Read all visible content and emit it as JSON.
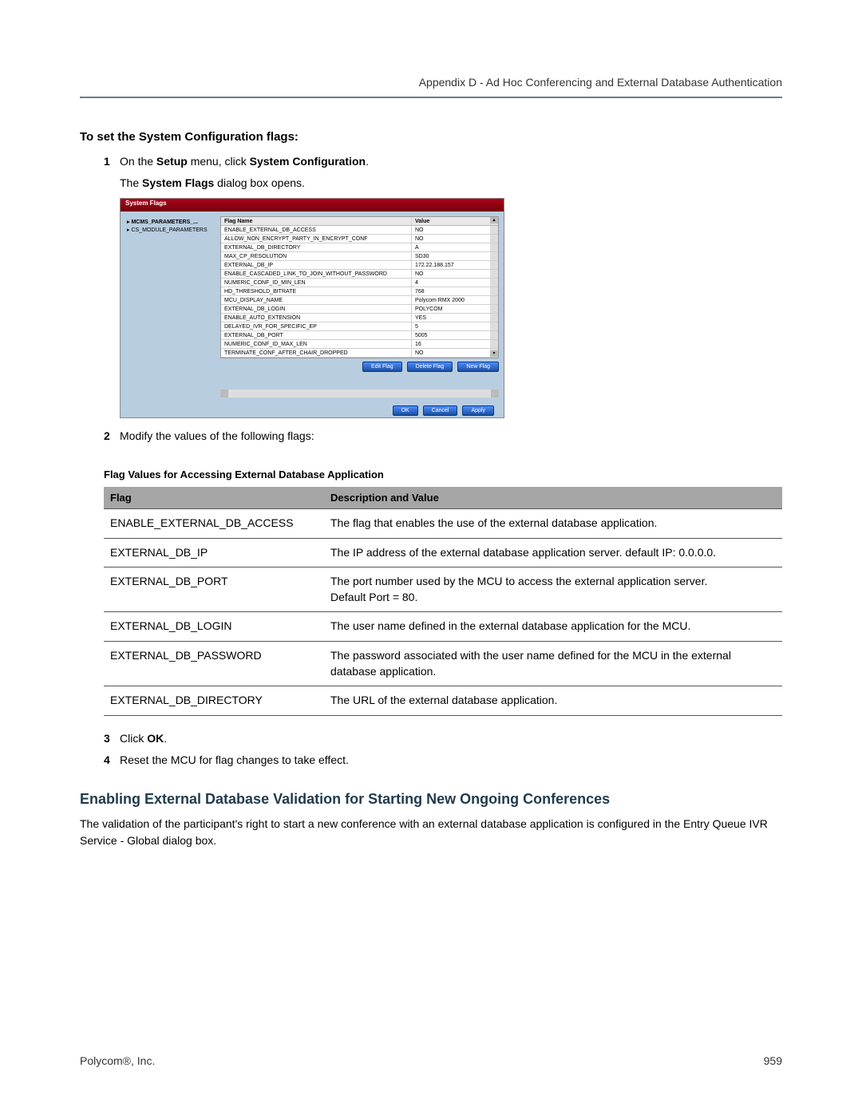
{
  "header": "Appendix D - Ad Hoc Conferencing and External Database Authentication",
  "section_title": "To set the System Configuration flags:",
  "step1_num": "1",
  "step1_a": "On the ",
  "step1_b": "Setup",
  "step1_c": " menu, click ",
  "step1_d": "System Configuration",
  "step1_e": ".",
  "step1_sub_a": "The ",
  "step1_sub_b": "System Flags",
  "step1_sub_c": " dialog box opens.",
  "dialog": {
    "title": "System Flags",
    "tree": [
      "MCMS_PARAMETERS_...",
      "CS_MODULE_PARAMETERS"
    ],
    "head_name": "Flag Name",
    "head_val": "Value",
    "rows": [
      {
        "n": "ENABLE_EXTERNAL_DB_ACCESS",
        "v": "NO"
      },
      {
        "n": "ALLOW_NON_ENCRYPT_PARTY_IN_ENCRYPT_CONF",
        "v": "NO"
      },
      {
        "n": "EXTERNAL_DB_DIRECTORY",
        "v": "A"
      },
      {
        "n": "MAX_CP_RESOLUTION",
        "v": "SD30"
      },
      {
        "n": "EXTERNAL_DB_IP",
        "v": "172.22.188.157"
      },
      {
        "n": "ENABLE_CASCADED_LINK_TO_JOIN_WITHOUT_PASSWORD",
        "v": "NO"
      },
      {
        "n": "NUMERIC_CONF_ID_MIN_LEN",
        "v": "4"
      },
      {
        "n": "HD_THRESHOLD_BITRATE",
        "v": "768"
      },
      {
        "n": "MCU_DISPLAY_NAME",
        "v": "Polycom RMX 2000"
      },
      {
        "n": "EXTERNAL_DB_LOGIN",
        "v": "POLYCOM"
      },
      {
        "n": "ENABLE_AUTO_EXTENSION",
        "v": "YES"
      },
      {
        "n": "DELAYED_IVR_FOR_SPECIFIC_EP",
        "v": "5"
      },
      {
        "n": "EXTERNAL_DB_PORT",
        "v": "5005"
      },
      {
        "n": "NUMERIC_CONF_ID_MAX_LEN",
        "v": "16"
      },
      {
        "n": "TERMINATE_CONF_AFTER_CHAIR_DROPPED",
        "v": "NO"
      }
    ],
    "btn_edit": "Edit Flag",
    "btn_delete": "Delete Flag",
    "btn_new": "New Flag",
    "btn_ok": "OK",
    "btn_cancel": "Cancel",
    "btn_apply": "Apply"
  },
  "step2_num": "2",
  "step2": "Modify the values of the following flags:",
  "tbl_caption": "Flag Values for Accessing External Database Application",
  "tbl_head_flag": "Flag",
  "tbl_head_desc": "Description and Value",
  "tbl_rows": [
    {
      "flag": "ENABLE_EXTERNAL_DB_ACCESS",
      "desc": "The flag that enables the use of the external database application."
    },
    {
      "flag": "EXTERNAL_DB_IP",
      "desc": "The IP address of the external database application server. default IP: 0.0.0.0."
    },
    {
      "flag": "EXTERNAL_DB_PORT",
      "desc": "The port number used by the MCU to access the external application server.\nDefault Port = 80."
    },
    {
      "flag": "EXTERNAL_DB_LOGIN",
      "desc": "The user name defined in the external database application for the MCU."
    },
    {
      "flag": "EXTERNAL_DB_PASSWORD",
      "desc": "The password associated with the user name defined for the MCU in the external database application."
    },
    {
      "flag": "EXTERNAL_DB_DIRECTORY",
      "desc": "The URL of the external database application."
    }
  ],
  "step3_num": "3",
  "step3_a": "Click ",
  "step3_b": "OK",
  "step3_c": ".",
  "step4_num": "4",
  "step4": "Reset the MCU for flag changes to take effect.",
  "h2": "Enabling External Database Validation for Starting New Ongoing Conferences",
  "para1": "The validation of the participant's right to start a new conference with an external database application is configured in the Entry Queue IVR Service - Global dialog box.",
  "footer_left": "Polycom®, Inc.",
  "footer_right": "959"
}
